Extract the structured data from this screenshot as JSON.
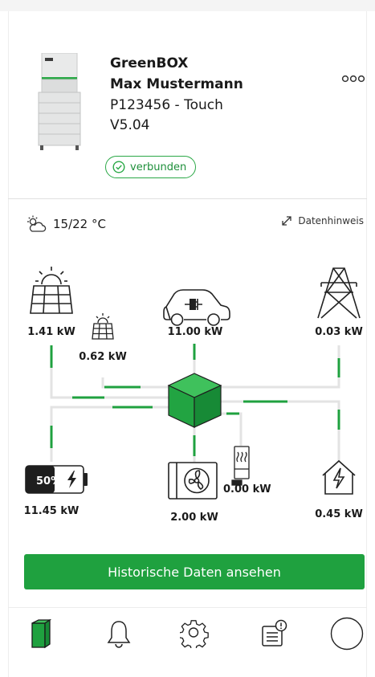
{
  "device": {
    "name": "GreenBOX",
    "owner": "Max Mustermann",
    "serial": "P123456 - Touch",
    "version": "V5.04",
    "status": "verbunden"
  },
  "weather": {
    "temperature": "15/22 °C",
    "icon": "cloud-sun-icon"
  },
  "data_hint": "Datenhinweis",
  "flow": {
    "pv_main": "1.41 kW",
    "pv_secondary": "0.62 kW",
    "ev_charger": "11.00 kW",
    "grid": "0.03 kW",
    "battery_soc": "50%",
    "battery_soc_fraction": 0.5,
    "battery_power": "11.45 kW",
    "heat_pump": "2.00 kW",
    "heating_rod": "0.00 kW",
    "house": "0.45 kW"
  },
  "history_button": "Historische Daten ansehen",
  "nav": [
    "device-icon",
    "bell-icon",
    "gear-icon",
    "notes-alert-icon",
    "profile-circle-icon"
  ],
  "colors": {
    "accent": "#1fa13f",
    "line_grey": "#e3e3e3"
  }
}
